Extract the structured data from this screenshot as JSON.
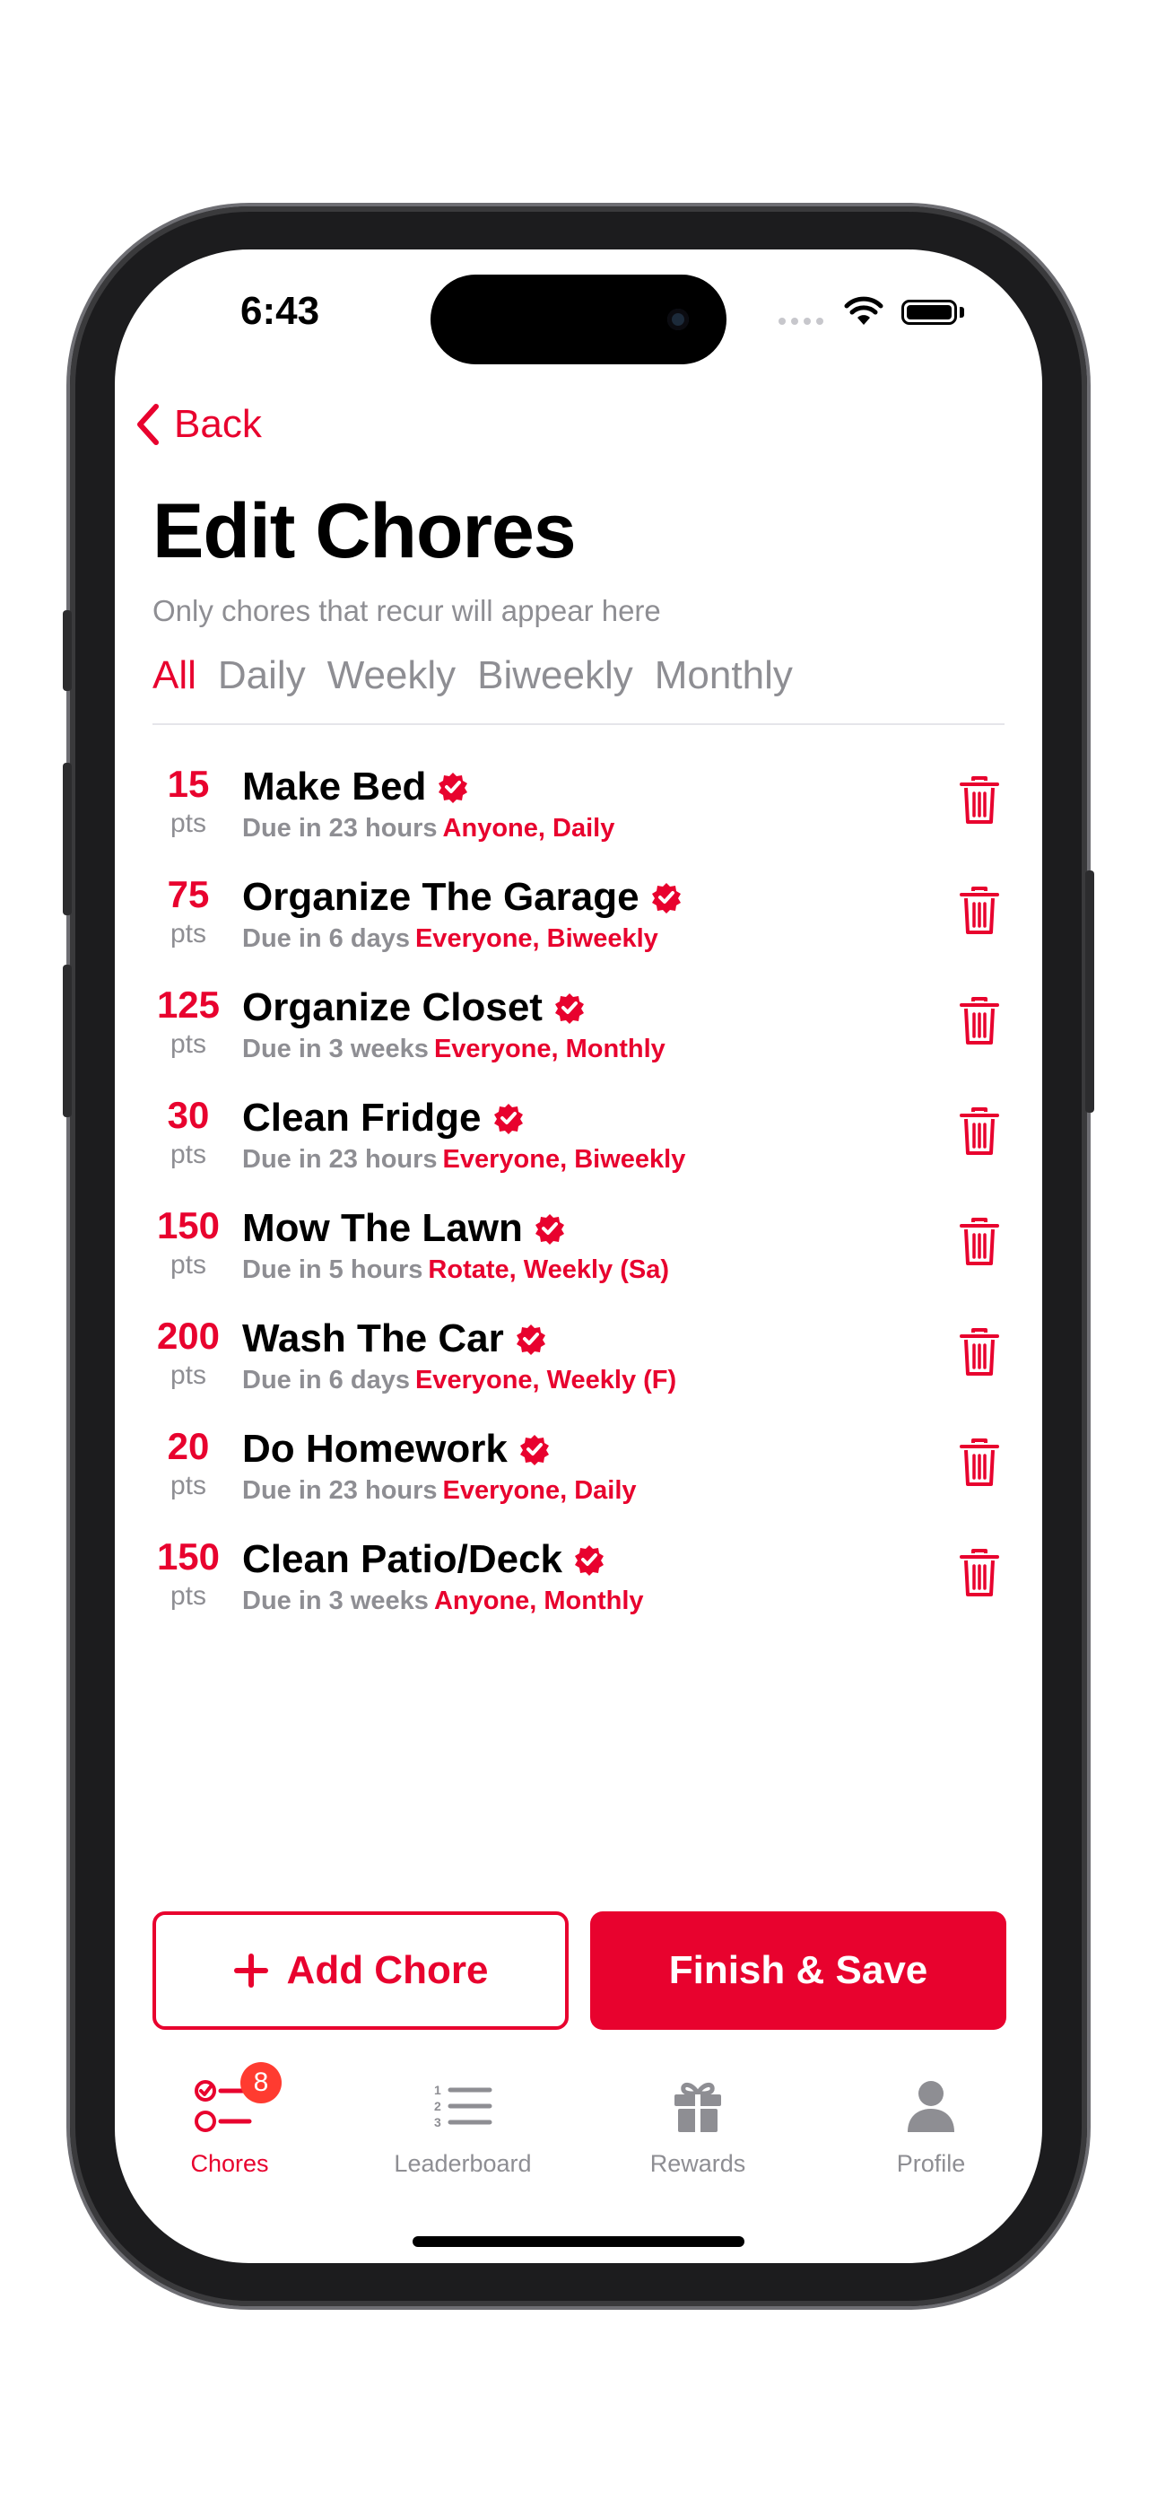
{
  "status": {
    "time": "6:43"
  },
  "nav": {
    "back_label": "Back"
  },
  "page": {
    "title": "Edit Chores",
    "subtitle": "Only chores that recur will appear here"
  },
  "filters": [
    "All",
    "Daily",
    "Weekly",
    "Biweekly",
    "Monthly"
  ],
  "active_filter": "All",
  "chores": [
    {
      "points": "15",
      "pts_label": "pts",
      "name": "Make Bed",
      "due": "Due in 23 hours",
      "tags": "Anyone, Daily"
    },
    {
      "points": "75",
      "pts_label": "pts",
      "name": "Organize The Garage",
      "due": "Due in 6 days",
      "tags": "Everyone, Biweekly"
    },
    {
      "points": "125",
      "pts_label": "pts",
      "name": "Organize Closet",
      "due": "Due in 3 weeks",
      "tags": "Everyone, Monthly"
    },
    {
      "points": "30",
      "pts_label": "pts",
      "name": "Clean Fridge",
      "due": "Due in 23 hours",
      "tags": "Everyone, Biweekly"
    },
    {
      "points": "150",
      "pts_label": "pts",
      "name": "Mow The Lawn",
      "due": "Due in 5 hours",
      "tags": "Rotate, Weekly (Sa)"
    },
    {
      "points": "200",
      "pts_label": "pts",
      "name": "Wash The Car",
      "due": "Due in 6 days",
      "tags": "Everyone, Weekly (F)"
    },
    {
      "points": "20",
      "pts_label": "pts",
      "name": "Do Homework",
      "due": "Due in 23 hours",
      "tags": "Everyone, Daily"
    },
    {
      "points": "150",
      "pts_label": "pts",
      "name": "Clean Patio/Deck",
      "due": "Due in 3 weeks",
      "tags": "Anyone, Monthly"
    }
  ],
  "actions": {
    "add_label": "Add Chore",
    "save_label": "Finish & Save"
  },
  "tabbar": {
    "tabs": [
      {
        "label": "Chores",
        "icon": "checklist-icon",
        "active": true,
        "badge": "8"
      },
      {
        "label": "Leaderboard",
        "icon": "numbered-list-icon",
        "active": false
      },
      {
        "label": "Rewards",
        "icon": "gift-icon",
        "active": false
      },
      {
        "label": "Profile",
        "icon": "person-icon",
        "active": false
      }
    ]
  },
  "colors": {
    "accent": "#e8022e",
    "secondary_text": "#8e8e93",
    "badge": "#ff3b30"
  }
}
